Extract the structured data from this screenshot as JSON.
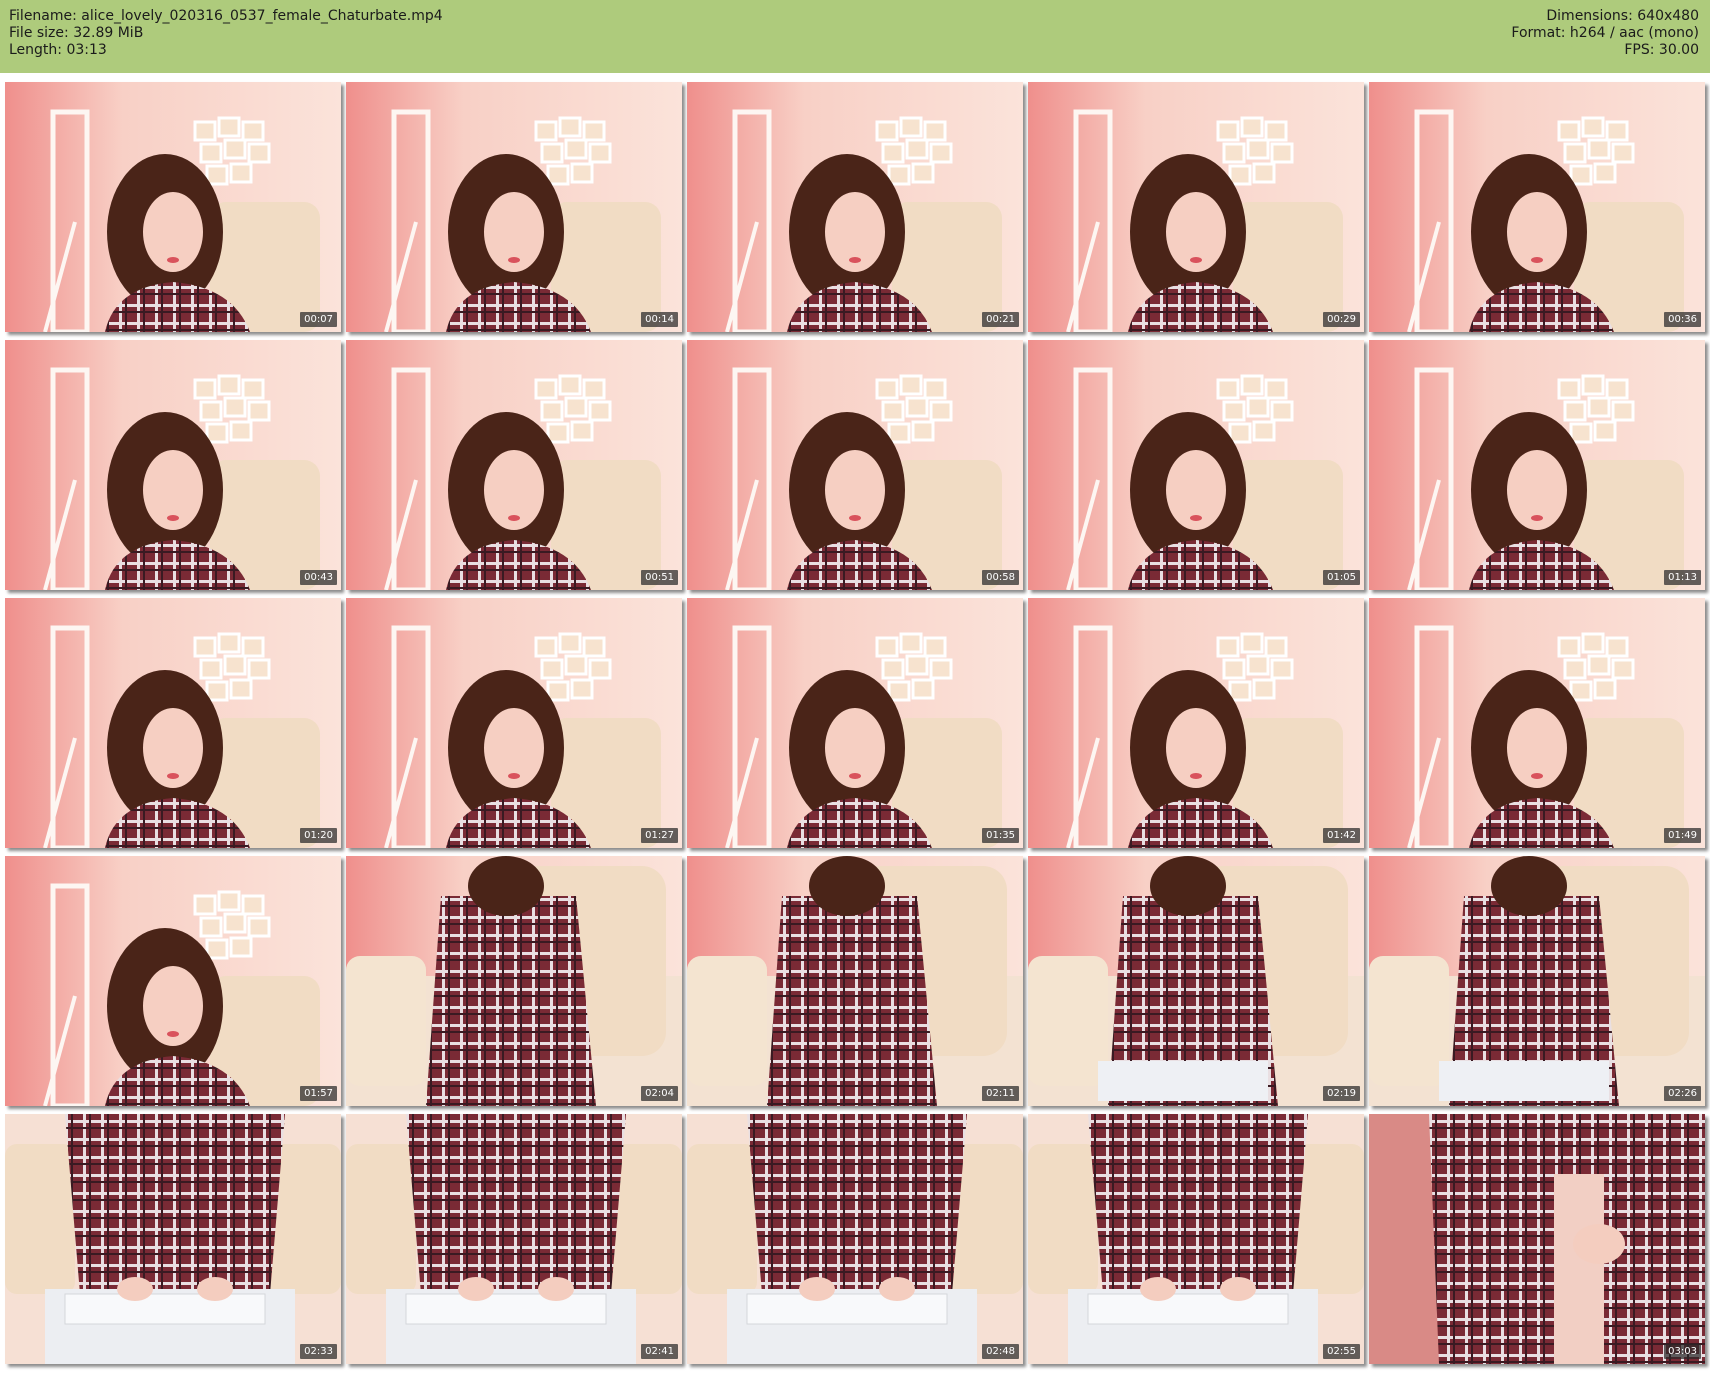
{
  "header": {
    "filename": "Filename: alice_lovely_020316_0537_female_Chaturbate.mp4",
    "filesize": "File size: 32.89 MiB",
    "length": "Length: 03:13",
    "dimensions": "Dimensions: 640x480",
    "format": "Format: h264 / aac (mono)",
    "fps": "FPS: 30.00"
  },
  "colors": {
    "header_bg": "#aecb7c",
    "wall": "#f4c4bd",
    "shirt": "#7a2a35",
    "chair": "#f1dcc4",
    "timestamp_bg": "#3a3a3a"
  },
  "thumbnails": [
    {
      "time": "00:07",
      "scene": "portrait"
    },
    {
      "time": "00:14",
      "scene": "portrait"
    },
    {
      "time": "00:21",
      "scene": "portrait"
    },
    {
      "time": "00:29",
      "scene": "portrait"
    },
    {
      "time": "00:36",
      "scene": "portrait"
    },
    {
      "time": "00:43",
      "scene": "portrait"
    },
    {
      "time": "00:51",
      "scene": "portrait"
    },
    {
      "time": "00:58",
      "scene": "portrait"
    },
    {
      "time": "01:05",
      "scene": "portrait"
    },
    {
      "time": "01:13",
      "scene": "portrait"
    },
    {
      "time": "01:20",
      "scene": "portrait"
    },
    {
      "time": "01:27",
      "scene": "portrait"
    },
    {
      "time": "01:35",
      "scene": "portrait"
    },
    {
      "time": "01:42",
      "scene": "portrait"
    },
    {
      "time": "01:49",
      "scene": "portrait"
    },
    {
      "time": "01:57",
      "scene": "portrait"
    },
    {
      "time": "02:04",
      "scene": "standing"
    },
    {
      "time": "02:11",
      "scene": "standing"
    },
    {
      "time": "02:19",
      "scene": "seated"
    },
    {
      "time": "02:26",
      "scene": "seated"
    },
    {
      "time": "02:33",
      "scene": "keyboard"
    },
    {
      "time": "02:41",
      "scene": "keyboard"
    },
    {
      "time": "02:48",
      "scene": "keyboard"
    },
    {
      "time": "02:55",
      "scene": "keyboard"
    },
    {
      "time": "03:03",
      "scene": "closeup"
    }
  ]
}
